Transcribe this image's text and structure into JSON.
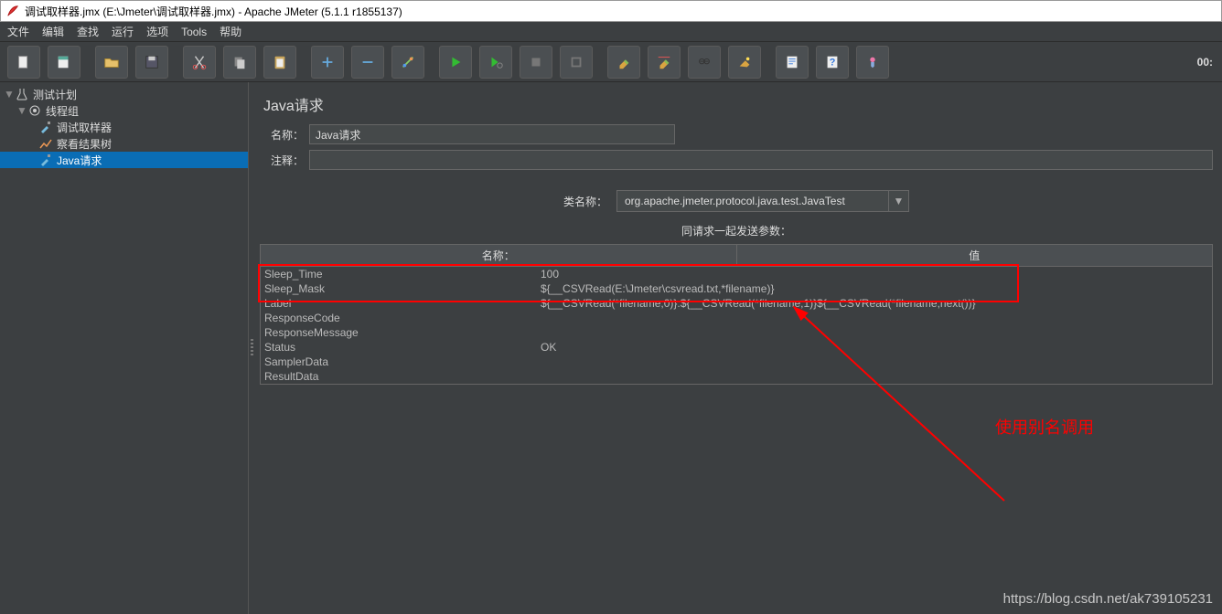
{
  "title": "调试取样器.jmx (E:\\Jmeter\\调试取样器.jmx) - Apache JMeter (5.1.1 r1855137)",
  "menu": {
    "file": "文件",
    "edit": "编辑",
    "search": "查找",
    "run": "运行",
    "options": "选项",
    "tools": "Tools",
    "help": "帮助"
  },
  "timer": "00:",
  "tree": {
    "root": "测试计划",
    "group": "线程组",
    "debug": "调试取样器",
    "result": "察看结果树",
    "java": "Java请求"
  },
  "panel": {
    "title": "Java请求",
    "name_lbl": "名称：",
    "name_val": "Java请求",
    "comment_lbl": "注释：",
    "comment_val": "",
    "class_lbl": "类名称：",
    "class_val": "org.apache.jmeter.protocol.java.test.JavaTest",
    "params_hdr": "同请求一起发送参数：",
    "col_name": "名称：",
    "col_val": "值",
    "rows": [
      {
        "n": "Sleep_Time",
        "v": "100"
      },
      {
        "n": "Sleep_Mask",
        "v": "${__CSVRead(E:\\Jmeter\\csvread.txt,*filename)}"
      },
      {
        "n": "Label",
        "v": "${__CSVRead(*filename,0)}:${__CSVRead(*filename,1)}${__CSVRead(*filename,next())}"
      },
      {
        "n": "ResponseCode",
        "v": ""
      },
      {
        "n": "ResponseMessage",
        "v": ""
      },
      {
        "n": "Status",
        "v": "OK"
      },
      {
        "n": "SamplerData",
        "v": ""
      },
      {
        "n": "ResultData",
        "v": ""
      }
    ]
  },
  "annotation": "使用别名调用",
  "watermark": "https://blog.csdn.net/ak739105231"
}
